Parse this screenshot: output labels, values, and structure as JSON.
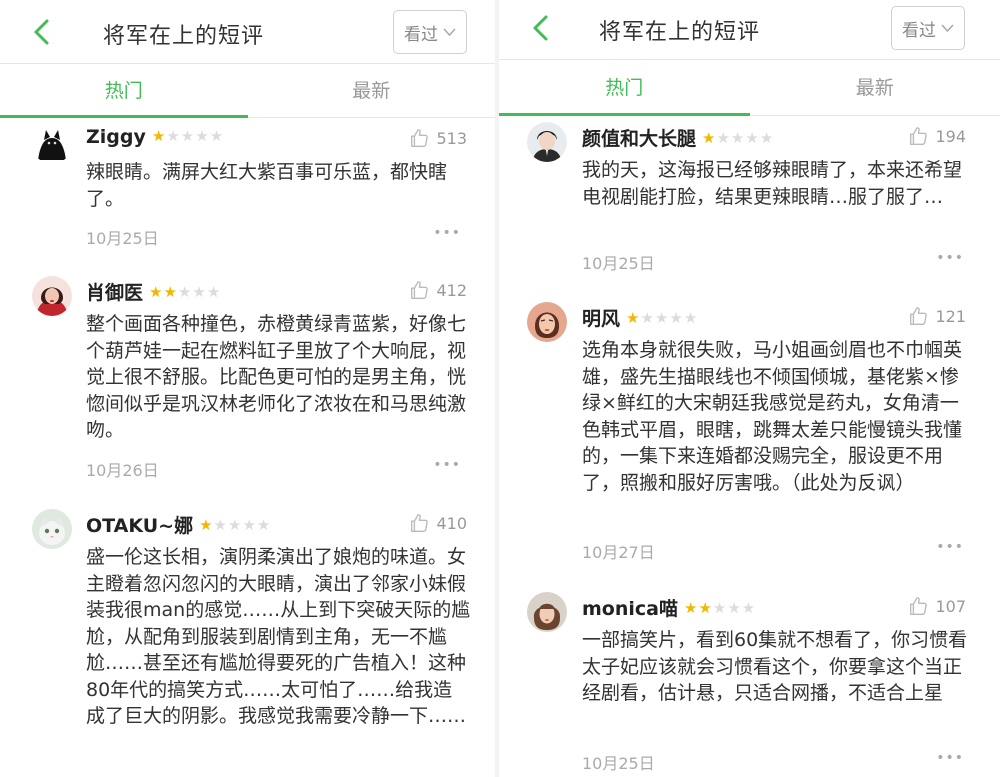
{
  "panels": [
    {
      "title": "将军在上的短评",
      "seen_label": "看过",
      "tabs": {
        "hot": "热门",
        "latest": "最新"
      },
      "comments": [
        {
          "name": "Ziggy",
          "rating": 1,
          "likes": "513",
          "text": "辣眼睛。满屏大红大紫百事可乐蓝，都快瞎了。",
          "date": "10月25日"
        },
        {
          "name": "肖御医",
          "rating": 2,
          "likes": "412",
          "text": "整个画面各种撞色，赤橙黄绿青蓝紫，好像七个葫芦娃一起在燃料缸子里放了个大响屁，视觉上很不舒服。比配色更可怕的是男主角，恍惚间似乎是巩汉林老师化了浓妆在和马思纯激吻。",
          "date": "10月26日"
        },
        {
          "name": "OTAKU~娜",
          "rating": 1,
          "likes": "410",
          "text": "盛一伦这长相，演阴柔演出了娘炮的味道。女主瞪着忽闪忽闪的大眼睛，演出了邻家小妹假装我很man的感觉……从上到下突破天际的尴尬，从配角到服装到剧情到主角，无一不尴尬……甚至还有尴尬得要死的广告植入！这种80年代的搞笑方式……太可怕了……给我造成了巨大的阴影。我感觉我需要冷静一下……",
          "date": ""
        }
      ]
    },
    {
      "title": "将军在上的短评",
      "seen_label": "看过",
      "tabs": {
        "hot": "热门",
        "latest": "最新"
      },
      "comments": [
        {
          "name": "颜值和大长腿",
          "rating": 1,
          "likes": "194",
          "text": "我的天，这海报已经够辣眼睛了，本来还希望电视剧能打脸，结果更辣眼睛…服了服了…",
          "date": "10月25日"
        },
        {
          "name": "明风",
          "rating": 1,
          "likes": "121",
          "text": "选角本身就很失败，马小姐画剑眉也不巾帼英雄，盛先生描眼线也不倾国倾城，基佬紫×惨绿×鲜红的大宋朝廷我感觉是药丸，女角清一色韩式平眉，眼瞎，跳舞太差只能慢镜头我懂的，一集下来连婚都没赐完全，服设更不用了，照搬和服好厉害哦。（此处为反讽）",
          "date": "10月27日"
        },
        {
          "name": "monica喵",
          "rating": 2,
          "likes": "107",
          "text": "一部搞笑片，看到60集就不想看了，你习惯看太子妃应该就会习惯看这个，你要拿这个当正经剧看，估计悬，只适合网播，不适合上星",
          "date": "10月25日"
        }
      ]
    }
  ],
  "icons": {
    "back": "chevron-left-icon",
    "dropdown": "chevron-down-icon",
    "like": "thumbs-up-icon",
    "more": "more-dots-icon"
  },
  "colors": {
    "accent": "#42bd56",
    "star": "#f4b700",
    "star_off": "#dcdcdc",
    "muted": "#aaaaaa"
  }
}
